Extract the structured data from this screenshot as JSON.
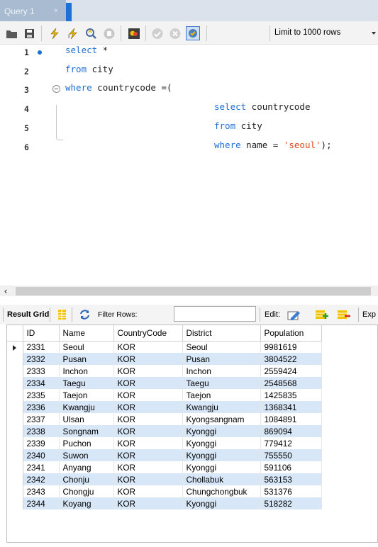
{
  "tab": {
    "title": "Query 1",
    "close": "×"
  },
  "toolbar": {
    "icons": [
      "open-folder-icon",
      "save-icon",
      "execute-icon",
      "execute-current-icon",
      "explain-icon",
      "stop-icon",
      "toggle-results-icon",
      "commit-icon",
      "rollback-icon",
      "autocommit-icon"
    ],
    "limit_label": "Limit to 1000 rows"
  },
  "editor": {
    "lines": [
      {
        "n": "1",
        "parts": [
          [
            "kw",
            "select"
          ],
          [
            "plain",
            " *"
          ]
        ]
      },
      {
        "n": "2",
        "parts": [
          [
            "kw",
            "from"
          ],
          [
            "plain",
            " city"
          ]
        ]
      },
      {
        "n": "3",
        "parts": [
          [
            "kw",
            "where"
          ],
          [
            "plain",
            " countrycode =("
          ]
        ]
      },
      {
        "n": "4",
        "parts": [
          [
            "kw",
            "select"
          ],
          [
            "plain",
            " countrycode"
          ]
        ]
      },
      {
        "n": "5",
        "parts": [
          [
            "kw",
            "from"
          ],
          [
            "plain",
            " city"
          ]
        ]
      },
      {
        "n": "6",
        "parts": [
          [
            "kw",
            "where"
          ],
          [
            "plain",
            " name = "
          ],
          [
            "str",
            "'seoul'"
          ],
          [
            "plain",
            ");"
          ]
        ]
      }
    ]
  },
  "result_toolbar": {
    "result_grid": "Result Grid",
    "filter_rows": "Filter Rows:",
    "filter_value": "",
    "edit": "Edit:",
    "export": "Exp"
  },
  "grid": {
    "columns": [
      "ID",
      "Name",
      "CountryCode",
      "District",
      "Population"
    ],
    "rows": [
      [
        "2331",
        "Seoul",
        "KOR",
        "Seoul",
        "9981619"
      ],
      [
        "2332",
        "Pusan",
        "KOR",
        "Pusan",
        "3804522"
      ],
      [
        "2333",
        "Inchon",
        "KOR",
        "Inchon",
        "2559424"
      ],
      [
        "2334",
        "Taegu",
        "KOR",
        "Taegu",
        "2548568"
      ],
      [
        "2335",
        "Taejon",
        "KOR",
        "Taejon",
        "1425835"
      ],
      [
        "2336",
        "Kwangju",
        "KOR",
        "Kwangju",
        "1368341"
      ],
      [
        "2337",
        "Ulsan",
        "KOR",
        "Kyongsangnam",
        "1084891"
      ],
      [
        "2338",
        "Songnam",
        "KOR",
        "Kyonggi",
        "869094"
      ],
      [
        "2339",
        "Puchon",
        "KOR",
        "Kyonggi",
        "779412"
      ],
      [
        "2340",
        "Suwon",
        "KOR",
        "Kyonggi",
        "755550"
      ],
      [
        "2341",
        "Anyang",
        "KOR",
        "Kyonggi",
        "591106"
      ],
      [
        "2342",
        "Chonju",
        "KOR",
        "Chollabuk",
        "563153"
      ],
      [
        "2343",
        "Chongju",
        "KOR",
        "Chungchongbuk",
        "531376"
      ],
      [
        "2344",
        "Koyang",
        "KOR",
        "Kyonggi",
        "518282"
      ]
    ]
  },
  "colors": {
    "tab_bg": "#a8bbd1",
    "tab_accent": "#1e6fd6",
    "keyword": "#1d6ed3",
    "string": "#dd4a1e",
    "row_alt": "#d8e7f8"
  }
}
